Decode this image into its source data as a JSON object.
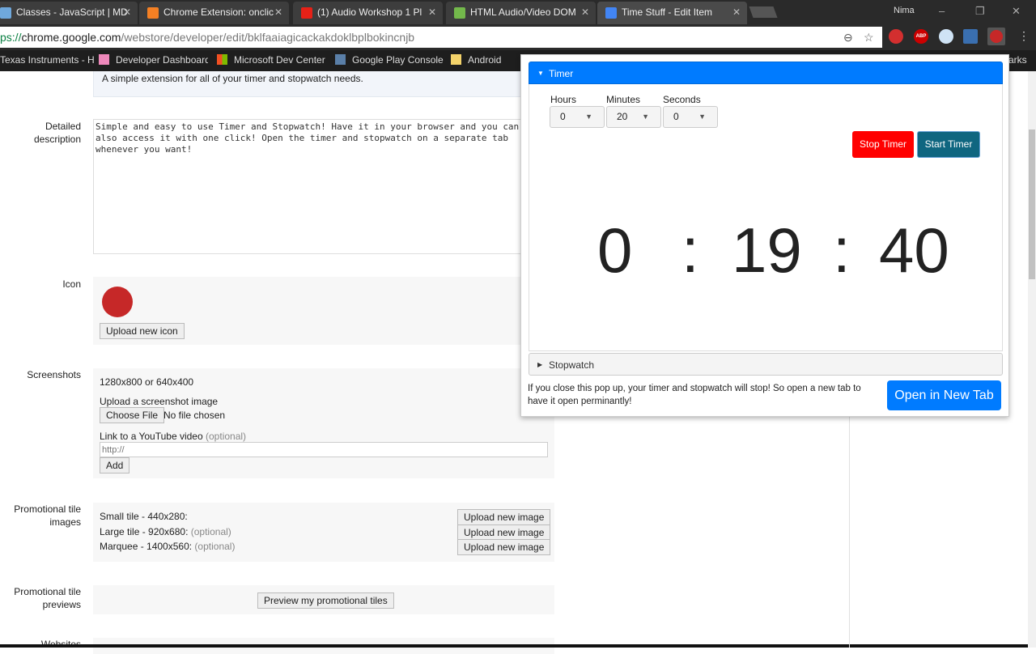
{
  "browser": {
    "tabs": [
      {
        "title": "Classes - JavaScript | MD",
        "icon": "mdn-icon",
        "color": "#6fa8dc"
      },
      {
        "title": "Chrome Extension: onclic",
        "icon": "stackoverflow-icon",
        "color": "#f48024"
      },
      {
        "title": "(1) Audio Workshop 1 Pl",
        "icon": "youtube-icon",
        "color": "#e62117"
      },
      {
        "title": "HTML Audio/Video DOM",
        "icon": "w3schools-icon",
        "color": "#73b84b"
      },
      {
        "title": "Time Stuff - Edit Item",
        "icon": "webstore-icon",
        "color": "#4285f4",
        "active": true
      }
    ],
    "user": "Nima",
    "url_scheme": "ps://",
    "url_host": "chrome.google.com",
    "url_path": "/webstore/developer/edit/bklfaaiagicackakdoklbplbokincnjb",
    "bookmarks": [
      {
        "label": "Texas Instruments - H",
        "icon": "ti-icon"
      },
      {
        "label": "Developer Dashboard",
        "icon": "webstore-icon"
      },
      {
        "label": "Microsoft Dev Center",
        "icon": "microsoft-icon"
      },
      {
        "label": "Google Play Console",
        "icon": "play-console-icon"
      },
      {
        "label": "Android",
        "icon": "folder-icon"
      }
    ],
    "other_bookmarks": "arks"
  },
  "page": {
    "summary": "A simple extension for all of your timer and stopwatch needs.",
    "detailed_label": "Detailed description",
    "detailed_text": "Simple and easy to use Timer and Stopwatch! Have it in your browser and you can also access it with one click! Open the timer and stopwatch on a separate tab whenever you want!",
    "icon_label": "Icon",
    "upload_icon": "Upload new icon",
    "screenshots_label": "Screenshots",
    "screenshot_size": "1280x800 or 640x400",
    "upload_screenshot": "Upload a screenshot image",
    "choose_file": "Choose File",
    "no_file": "No file chosen",
    "youtube_label": "Link to a YouTube video",
    "optional": "(optional)",
    "youtube_placeholder": "http://",
    "add": "Add",
    "promo_label": "Promotional tile images",
    "small_tile": "Small tile - 440x280:",
    "large_tile": "Large tile - 920x680:",
    "marquee": "Marquee - 1400x560:",
    "upload_image": "Upload new image",
    "previews_label": "Promotional tile previews",
    "preview_btn": "Preview my promotional tiles",
    "websites_label": "Websites"
  },
  "popup": {
    "timer_title": "Timer",
    "hours_label": "Hours",
    "minutes_label": "Minutes",
    "seconds_label": "Seconds",
    "hours": "0",
    "minutes": "20",
    "seconds": "0",
    "stop": "Stop Timer",
    "start": "Start Timer",
    "display_h": "0",
    "display_m": "19",
    "display_s": "40",
    "sep": ":",
    "stopwatch_title": "Stopwatch",
    "note": "If you close this pop up, your timer and stopwatch will stop! So open a new tab to have it open perminantly!",
    "open_tab": "Open in New Tab",
    "colors": {
      "primary": "#007bff",
      "danger": "#ff0000",
      "start": "#0f6680"
    }
  }
}
